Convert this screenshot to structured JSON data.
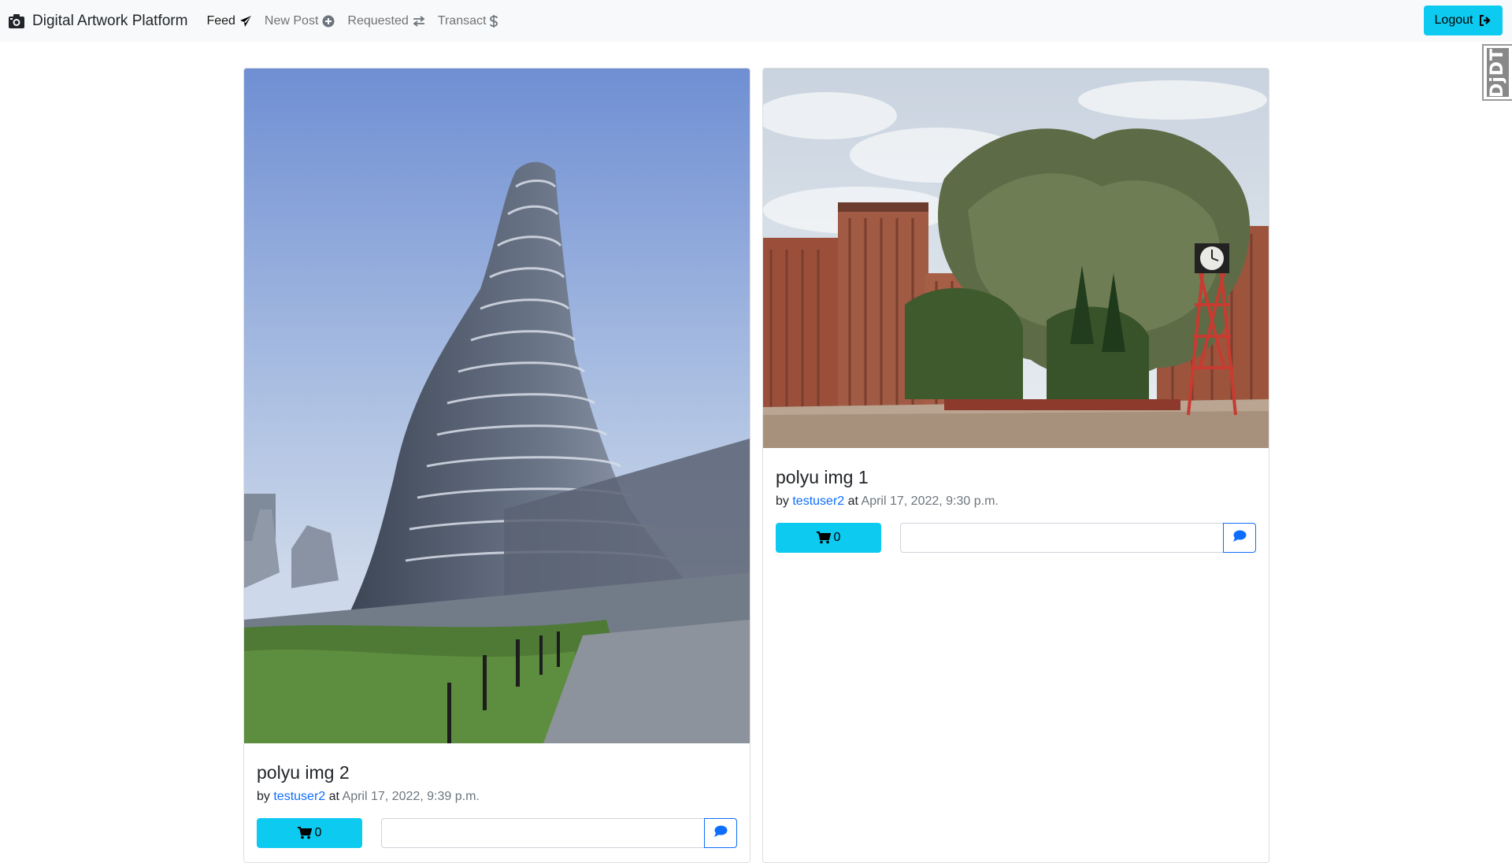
{
  "navbar": {
    "brand": "Digital Artwork Platform",
    "brand_icon": "camera-icon",
    "items": [
      {
        "label": "Feed",
        "icon": "paper-plane-icon",
        "active": true
      },
      {
        "label": "New Post",
        "icon": "plus-circle-icon",
        "active": false
      },
      {
        "label": "Requested",
        "icon": "exchange-arrows-icon",
        "active": false
      },
      {
        "label": "Transact",
        "icon": "dollar-icon",
        "active": false
      }
    ],
    "logout_label": "Logout",
    "logout_icon": "sign-out-icon"
  },
  "debug_toolbar": {
    "label": "DjDT"
  },
  "posts": [
    {
      "title": "polyu img 2",
      "by_prefix": "by",
      "author": "testuser2",
      "at_prefix": "at",
      "timestamp": "April 17, 2022, 9:39 p.m.",
      "cart_count": "0",
      "comment_value": "",
      "image_desc": "curved-futuristic-tower-photo"
    },
    {
      "title": "polyu img 1",
      "by_prefix": "by",
      "author": "testuser2",
      "at_prefix": "at",
      "timestamp": "April 17, 2022, 9:30 p.m.",
      "cart_count": "0",
      "comment_value": "",
      "image_desc": "campus-tree-clock-tower-photo"
    }
  ],
  "colors": {
    "accent": "#0dcaf0",
    "link": "#0d6efd",
    "navbar_bg": "#f8f9fa"
  }
}
